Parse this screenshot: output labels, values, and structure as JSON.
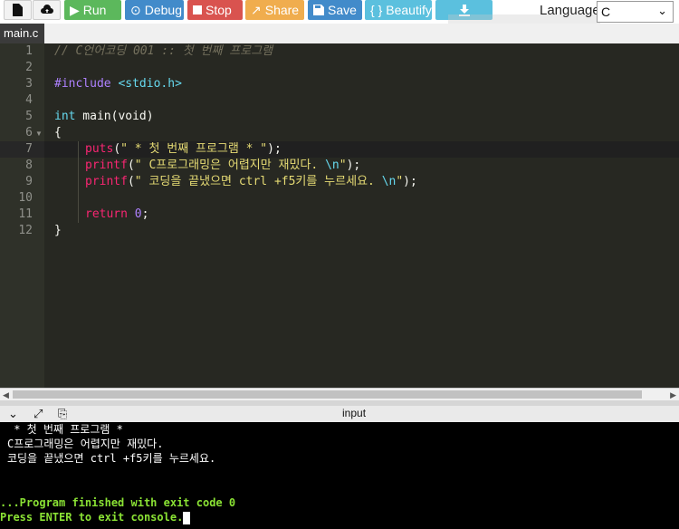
{
  "toolbar": {
    "buttons": [
      {
        "name": "new-file-button",
        "icon": "file-icon",
        "label": "",
        "color": "#f2f2f2"
      },
      {
        "name": "upload-button",
        "icon": "upload-icon",
        "label": "",
        "color": "#f2f2f2"
      },
      {
        "name": "run-button",
        "icon": "play-icon",
        "label": "Run",
        "color": "#5cb85c"
      },
      {
        "name": "debug-button",
        "icon": "debug-icon",
        "label": "Debug",
        "color": "#428bca"
      },
      {
        "name": "stop-button",
        "icon": "stop-icon",
        "label": "Stop",
        "color": "#d9534f"
      },
      {
        "name": "share-button",
        "icon": "share-icon",
        "label": "Share",
        "color": "#f0ad4e"
      },
      {
        "name": "save-button",
        "icon": "save-icon",
        "label": "Save",
        "color": "#428bca"
      },
      {
        "name": "beautify-button",
        "icon": "braces-icon",
        "label": "Beautify",
        "color": "#5bc0de"
      },
      {
        "name": "download-button",
        "icon": "download-icon",
        "label": "",
        "color": "#5bc0de"
      }
    ],
    "language_label": "Language",
    "language_value": "C"
  },
  "file_tab": "main.c",
  "editor": {
    "lines": [
      {
        "no": "1"
      },
      {
        "no": "2"
      },
      {
        "no": "3"
      },
      {
        "no": "4"
      },
      {
        "no": "5"
      },
      {
        "no": "6"
      },
      {
        "no": "7"
      },
      {
        "no": "8"
      },
      {
        "no": "9"
      },
      {
        "no": "10"
      },
      {
        "no": "11"
      },
      {
        "no": "12"
      }
    ],
    "code": {
      "l1": "// C언어코딩 001 :: 첫 번째 프로그램",
      "l3_pp": "#include",
      "l3_hdr": "<stdio.h>",
      "l5_type": "int",
      "l5_rest": " main(void)",
      "l6": "{",
      "l7_fn": "puts",
      "l7_open": "(",
      "l7_str": "\" * 첫 번째 프로그램 * \"",
      "l7_close": ");",
      "l8_fn": "printf",
      "l8_open": "(",
      "l8_str": "\" C프로그래밍은 어렵지만 재밌다. ",
      "l8_esc": "\\n",
      "l8_strend": "\"",
      "l8_close": ");",
      "l9_fn": "printf",
      "l9_open": "(",
      "l9_str": "\" 코딩을 끝냈으면 ctrl +f5키를 누르세요. ",
      "l9_esc": "\\n",
      "l9_strend": "\"",
      "l9_close": ");",
      "l11_kw": "return",
      "l11_num": "0",
      "l11_semi": ";",
      "l12": "}"
    }
  },
  "console_bar": {
    "label": "input"
  },
  "console": {
    "out1": " * 첫 번째 프로그램 *",
    "out2": "C프로그래밍은 어렵지만 재밌다.",
    "out3": "코딩을 끝냈으면 ctrl +f5키를 누르세요.",
    "finish": "...Program finished with exit code 0",
    "press": "Press ENTER to exit console."
  }
}
